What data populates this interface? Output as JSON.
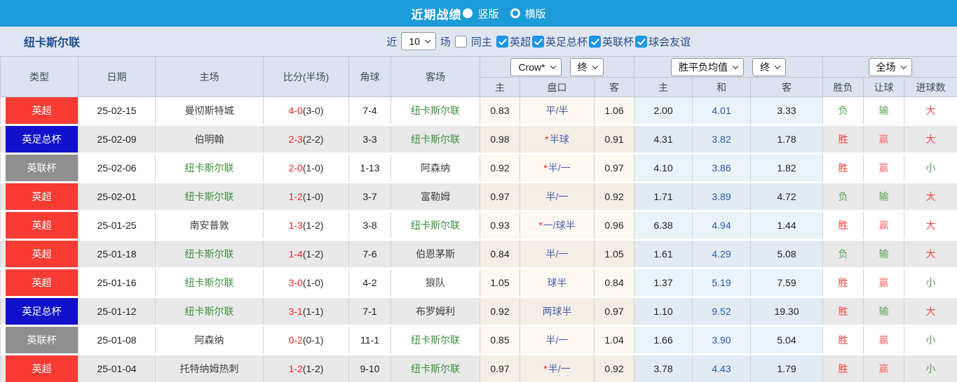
{
  "topbar": {
    "title": "近期战绩",
    "radio_vertical_label": "竖版",
    "radio_horizontal_label": "横版",
    "selected_layout": "竖版",
    "bar_color": "#1b9bd8"
  },
  "filter": {
    "team": "纽卡斯尔联",
    "near_label": "近",
    "count_value": "10",
    "games_label": "场",
    "same_home_label": "同主",
    "same_home_checked": false,
    "leagues": [
      "英超",
      "英足总杯",
      "英联杯",
      "球会友谊"
    ],
    "leagues_checked": [
      true,
      true,
      true,
      true
    ]
  },
  "selectors": {
    "bookmaker": "Crow*",
    "bookmaker_time": "终",
    "avg_type": "胜平负均值",
    "avg_time": "终",
    "scope": "全场"
  },
  "table": {
    "headers": {
      "type": "类型",
      "date": "日期",
      "home": "主场",
      "score": "比分(半场)",
      "corner": "角球",
      "away": "客场"
    },
    "sub_headers": [
      "主",
      "盘口",
      "客",
      "主",
      "和",
      "客",
      "胜负",
      "让球",
      "进球数"
    ],
    "type_colors": {
      "英超": "#f83b33",
      "英足总杯": "#1111cc",
      "英联杯": "#8f8f8f"
    },
    "rows": [
      {
        "type": "英超",
        "date": "25-02-15",
        "home": "曼彻斯特城",
        "home_self": false,
        "score": "4-0",
        "half": "3-0",
        "corner": "7-4",
        "away": "纽卡斯尔联",
        "away_self": true,
        "crow_home": "0.83",
        "handicap": "平/半",
        "crow_away": "1.06",
        "avg_home": "2.00",
        "avg_draw": "4.01",
        "avg_away": "3.33",
        "result": "负",
        "handicap_result": "输",
        "goals": "大"
      },
      {
        "type": "英足总杯",
        "date": "25-02-09",
        "home": "伯明翰",
        "home_self": false,
        "score": "2-3",
        "half": "2-2",
        "corner": "3-3",
        "away": "纽卡斯尔联",
        "away_self": true,
        "crow_home": "0.98",
        "handicap": "*半球",
        "crow_away": "0.91",
        "avg_home": "4.31",
        "avg_draw": "3.82",
        "avg_away": "1.78",
        "result": "胜",
        "handicap_result": "赢",
        "goals": "大"
      },
      {
        "type": "英联杯",
        "date": "25-02-06",
        "home": "纽卡斯尔联",
        "home_self": true,
        "score": "2-0",
        "half": "1-0",
        "corner": "1-13",
        "away": "阿森纳",
        "away_self": false,
        "crow_home": "0.92",
        "handicap": "*半/一",
        "crow_away": "0.97",
        "avg_home": "4.10",
        "avg_draw": "3.86",
        "avg_away": "1.82",
        "result": "胜",
        "handicap_result": "赢",
        "goals": "小"
      },
      {
        "type": "英超",
        "date": "25-02-01",
        "home": "纽卡斯尔联",
        "home_self": true,
        "score": "1-2",
        "half": "1-0",
        "corner": "3-7",
        "away": "富勒姆",
        "away_self": false,
        "crow_home": "0.97",
        "handicap": "半/一",
        "crow_away": "0.92",
        "avg_home": "1.71",
        "avg_draw": "3.89",
        "avg_away": "4.72",
        "result": "负",
        "handicap_result": "输",
        "goals": "大"
      },
      {
        "type": "英超",
        "date": "25-01-25",
        "home": "南安普敦",
        "home_self": false,
        "score": "1-3",
        "half": "1-2",
        "corner": "3-8",
        "away": "纽卡斯尔联",
        "away_self": true,
        "crow_home": "0.93",
        "handicap": "*一/球半",
        "crow_away": "0.96",
        "avg_home": "6.38",
        "avg_draw": "4.94",
        "avg_away": "1.44",
        "result": "胜",
        "handicap_result": "赢",
        "goals": "大"
      },
      {
        "type": "英超",
        "date": "25-01-18",
        "home": "纽卡斯尔联",
        "home_self": true,
        "score": "1-4",
        "half": "1-2",
        "corner": "7-6",
        "away": "伯恩茅斯",
        "away_self": false,
        "crow_home": "0.84",
        "handicap": "半/一",
        "crow_away": "1.05",
        "avg_home": "1.61",
        "avg_draw": "4.29",
        "avg_away": "5.08",
        "result": "负",
        "handicap_result": "输",
        "goals": "大"
      },
      {
        "type": "英超",
        "date": "25-01-16",
        "home": "纽卡斯尔联",
        "home_self": true,
        "score": "3-0",
        "half": "1-0",
        "corner": "4-2",
        "away": "狼队",
        "away_self": false,
        "crow_home": "1.05",
        "handicap": "球半",
        "crow_away": "0.84",
        "avg_home": "1.37",
        "avg_draw": "5.19",
        "avg_away": "7.59",
        "result": "胜",
        "handicap_result": "赢",
        "goals": "小"
      },
      {
        "type": "英足总杯",
        "date": "25-01-12",
        "home": "纽卡斯尔联",
        "home_self": true,
        "score": "3-1",
        "half": "1-1",
        "corner": "7-1",
        "away": "布罗姆利",
        "away_self": false,
        "crow_home": "0.92",
        "handicap": "两球半",
        "crow_away": "0.97",
        "avg_home": "1.10",
        "avg_draw": "9.52",
        "avg_away": "19.30",
        "result": "胜",
        "handicap_result": "输",
        "goals": "大"
      },
      {
        "type": "英联杯",
        "date": "25-01-08",
        "home": "阿森纳",
        "home_self": false,
        "score": "0-2",
        "half": "0-1",
        "corner": "11-1",
        "away": "纽卡斯尔联",
        "away_self": true,
        "crow_home": "0.85",
        "handicap": "半/一",
        "crow_away": "1.04",
        "avg_home": "1.66",
        "avg_draw": "3.90",
        "avg_away": "5.04",
        "result": "胜",
        "handicap_result": "赢",
        "goals": "小"
      },
      {
        "type": "英超",
        "date": "25-01-04",
        "home": "托特纳姆热刺",
        "home_self": false,
        "score": "1-2",
        "half": "1-2",
        "corner": "9-10",
        "away": "纽卡斯尔联",
        "away_self": true,
        "crow_home": "0.97",
        "handicap": "*半/一",
        "crow_away": "0.92",
        "avg_home": "3.78",
        "avg_draw": "4.43",
        "avg_away": "1.79",
        "result": "胜",
        "handicap_result": "赢",
        "goals": "小"
      }
    ]
  },
  "colors": {
    "topbar_blue": "#1b9bd8",
    "checkbox_blue": "#1d96e8",
    "badge_epl_red": "#f83b33",
    "badge_facup_blue": "#1111cc",
    "badge_leaguecup_gray": "#8f8f8f",
    "score_red": "#ff2020",
    "team_green": "#3f8f3f",
    "handicap_blue": "#4a5fa8",
    "avg_draw_blue": "#2a58a9",
    "win_red": "#ff3c3c",
    "lose_green": "#55a355"
  }
}
